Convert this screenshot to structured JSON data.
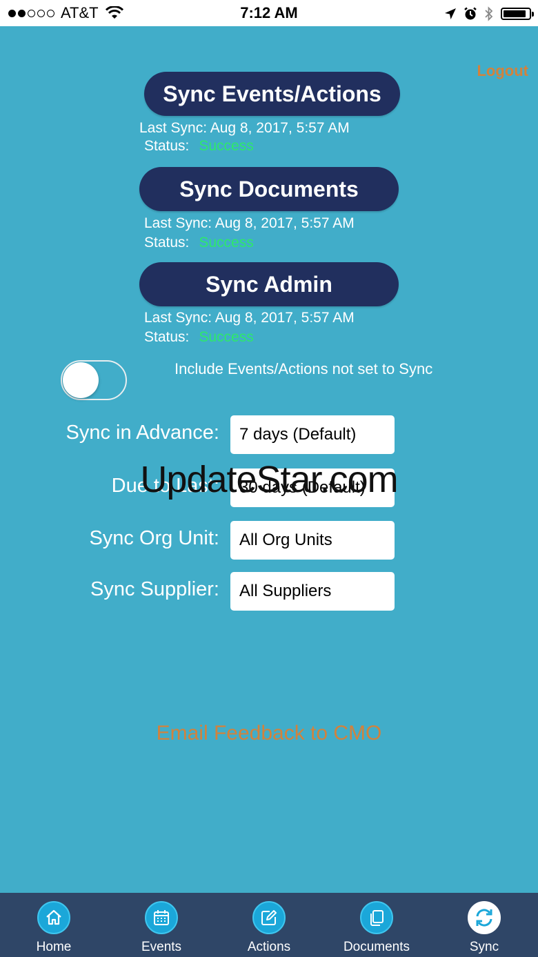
{
  "status_bar": {
    "carrier": "AT&T",
    "time": "7:12 AM"
  },
  "header": {
    "logout_label": "Logout"
  },
  "sync_sections": [
    {
      "button_label": "Sync Events/Actions",
      "last_sync": "Last Sync: Aug 8, 2017, 5:57 AM",
      "status_label": "Status:",
      "status_value": "Success"
    },
    {
      "button_label": "Sync Documents",
      "last_sync": "Last Sync: Aug 8, 2017, 5:57 AM",
      "status_label": "Status:",
      "status_value": "Success"
    },
    {
      "button_label": "Sync Admin",
      "last_sync": "Last Sync: Aug 8, 2017, 5:57 AM",
      "status_label": "Status:",
      "status_value": "Success"
    }
  ],
  "include_toggle": {
    "label": "Include Events/Actions not set to Sync",
    "on": false
  },
  "settings": [
    {
      "label": "Sync in Advance:",
      "value": "7 days (Default)"
    },
    {
      "label": "Due to Last:",
      "value": "30 days (Default)"
    },
    {
      "label": "Sync Org Unit:",
      "value": "All Org Units"
    },
    {
      "label": "Sync Supplier:",
      "value": "All Suppliers"
    }
  ],
  "watermark": "UpdateStar.com",
  "feedback_link": "Email Feedback to CMO",
  "tabs": [
    {
      "label": "Home",
      "icon": "home-icon"
    },
    {
      "label": "Events",
      "icon": "calendar-icon"
    },
    {
      "label": "Actions",
      "icon": "edit-icon"
    },
    {
      "label": "Documents",
      "icon": "documents-icon"
    },
    {
      "label": "Sync",
      "icon": "sync-icon",
      "active": true
    }
  ],
  "colors": {
    "background": "#41adc9",
    "button": "#212f5e",
    "accent_orange": "#d2823c",
    "success_green": "#2ee86b",
    "tabbar": "#2f4667"
  }
}
